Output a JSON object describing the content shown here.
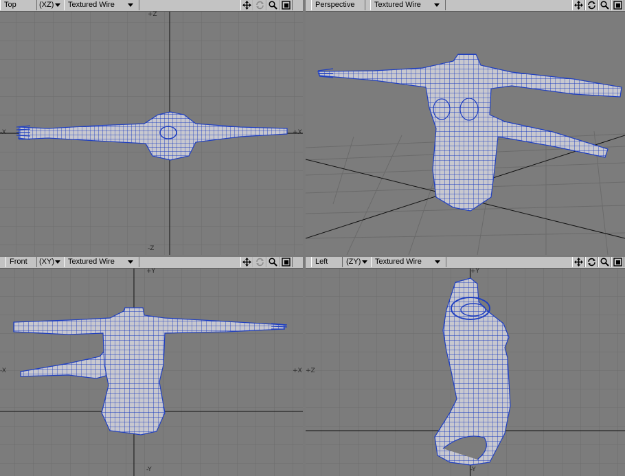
{
  "colors": {
    "wire": "#1f3fc0",
    "skin": "#c8c8cf",
    "grid": "#6c6c6c",
    "bg": "#7c7c7c"
  },
  "viewports": {
    "top": {
      "name": "Top",
      "axes": "(XZ)",
      "mode": "Textured Wire",
      "labels": {
        "top": "+Z",
        "bottom": "-Z",
        "left": "-X",
        "right": "+X"
      }
    },
    "perspective": {
      "name": "Perspective",
      "mode": "Textured Wire"
    },
    "front": {
      "name": "Front",
      "axes": "(XY)",
      "mode": "Textured Wire",
      "labels": {
        "top": "+Y",
        "bottom": "-Y",
        "left": "-X",
        "right": "+X"
      }
    },
    "left": {
      "name": "Left",
      "axes": "(ZY)",
      "mode": "Textured Wire",
      "labels": {
        "top": "+Y",
        "bottom": "-Y",
        "right": "+Z"
      }
    }
  },
  "icons": [
    "move-icon",
    "rotate-icon",
    "zoom-icon",
    "maximize-icon"
  ]
}
